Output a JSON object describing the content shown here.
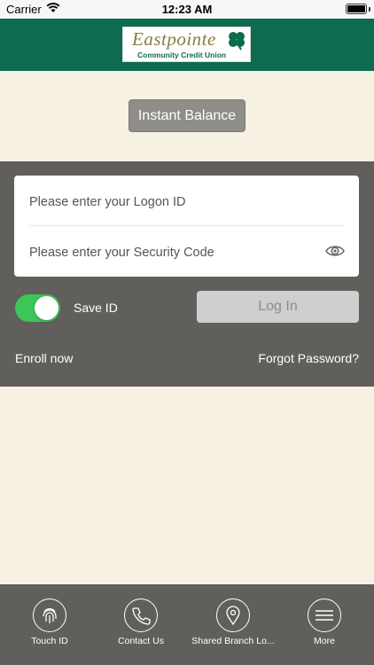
{
  "status_bar": {
    "carrier": "Carrier",
    "time": "12:23 AM"
  },
  "header": {
    "logo_name": "Eastpointe",
    "logo_sub": "Community Credit Union",
    "brand_color": "#0f6b4f"
  },
  "instant_balance": {
    "label": "Instant Balance"
  },
  "login": {
    "logon_placeholder": "Please enter your Logon ID",
    "security_placeholder": "Please enter your Security Code",
    "save_id_label": "Save ID",
    "save_id_on": true,
    "login_button": "Log In",
    "enroll_link": "Enroll now",
    "forgot_link": "Forgot Password?"
  },
  "bottom_nav": {
    "items": [
      {
        "label": "Touch ID",
        "icon": "fingerprint-icon"
      },
      {
        "label": "Contact Us",
        "icon": "phone-icon"
      },
      {
        "label": "Shared Branch Lo...",
        "icon": "map-pin-icon"
      },
      {
        "label": "More",
        "icon": "menu-icon"
      }
    ]
  },
  "colors": {
    "toggle_on": "#3cc65a",
    "panel": "#605f5b",
    "background": "#f7f1e4"
  }
}
